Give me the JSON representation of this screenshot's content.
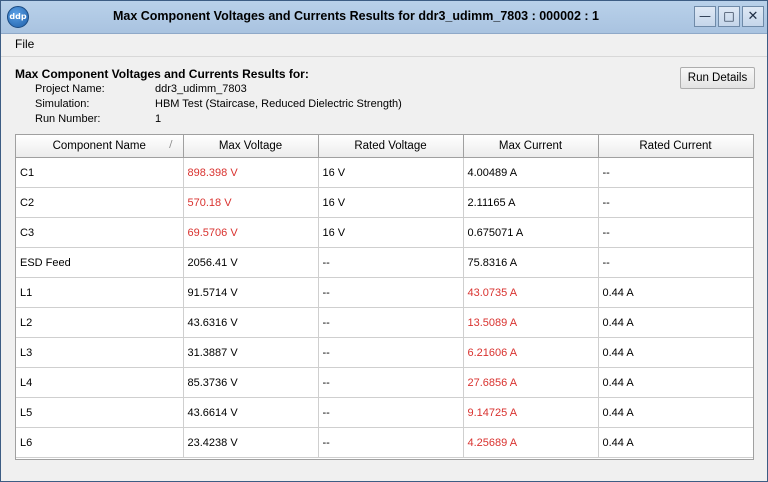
{
  "window": {
    "title": "Max Component Voltages and Currents Results for ddr3_udimm_7803 : 000002 : 1",
    "app_icon_text": "ddp",
    "minimize_glyph": "—",
    "maximize_glyph": "□",
    "close_glyph": "✕"
  },
  "menu": {
    "file": "File"
  },
  "header": {
    "heading": "Max Component Voltages and Currents Results for:",
    "project_label": "Project Name:",
    "project_value": "ddr3_udimm_7803",
    "simulation_label": "Simulation:",
    "simulation_value": "HBM Test (Staircase, Reduced Dielectric Strength)",
    "run_label": "Run Number:",
    "run_value": "1",
    "run_details_button": "Run Details"
  },
  "table": {
    "columns": [
      "Component Name",
      "Max Voltage",
      "Rated Voltage",
      "Max Current",
      "Rated Current"
    ],
    "sort_indicator": "/",
    "rows": [
      {
        "name": "C1",
        "max_voltage": "898.398 V",
        "rated_voltage": "16 V",
        "max_current": "4.00489 A",
        "rated_current": "--",
        "voltage_exceeded": true,
        "current_exceeded": false
      },
      {
        "name": "C2",
        "max_voltage": "570.18 V",
        "rated_voltage": "16 V",
        "max_current": "2.11165 A",
        "rated_current": "--",
        "voltage_exceeded": true,
        "current_exceeded": false
      },
      {
        "name": "C3",
        "max_voltage": "69.5706 V",
        "rated_voltage": "16 V",
        "max_current": "0.675071 A",
        "rated_current": "--",
        "voltage_exceeded": true,
        "current_exceeded": false
      },
      {
        "name": "ESD Feed",
        "max_voltage": "2056.41 V",
        "rated_voltage": "--",
        "max_current": "75.8316 A",
        "rated_current": "--",
        "voltage_exceeded": false,
        "current_exceeded": false
      },
      {
        "name": "L1",
        "max_voltage": "91.5714 V",
        "rated_voltage": "--",
        "max_current": "43.0735 A",
        "rated_current": "0.44 A",
        "voltage_exceeded": false,
        "current_exceeded": true
      },
      {
        "name": "L2",
        "max_voltage": "43.6316 V",
        "rated_voltage": "--",
        "max_current": "13.5089 A",
        "rated_current": "0.44 A",
        "voltage_exceeded": false,
        "current_exceeded": true
      },
      {
        "name": "L3",
        "max_voltage": "31.3887 V",
        "rated_voltage": "--",
        "max_current": "6.21606 A",
        "rated_current": "0.44 A",
        "voltage_exceeded": false,
        "current_exceeded": true
      },
      {
        "name": "L4",
        "max_voltage": "85.3736 V",
        "rated_voltage": "--",
        "max_current": "27.6856 A",
        "rated_current": "0.44 A",
        "voltage_exceeded": false,
        "current_exceeded": true
      },
      {
        "name": "L5",
        "max_voltage": "43.6614 V",
        "rated_voltage": "--",
        "max_current": "9.14725 A",
        "rated_current": "0.44 A",
        "voltage_exceeded": false,
        "current_exceeded": true
      },
      {
        "name": "L6",
        "max_voltage": "23.4238 V",
        "rated_voltage": "--",
        "max_current": "4.25689 A",
        "rated_current": "0.44 A",
        "voltage_exceeded": false,
        "current_exceeded": true
      }
    ]
  },
  "colors": {
    "exceeded_text": "#d9322f",
    "title_bar": "#b9d1ea"
  }
}
